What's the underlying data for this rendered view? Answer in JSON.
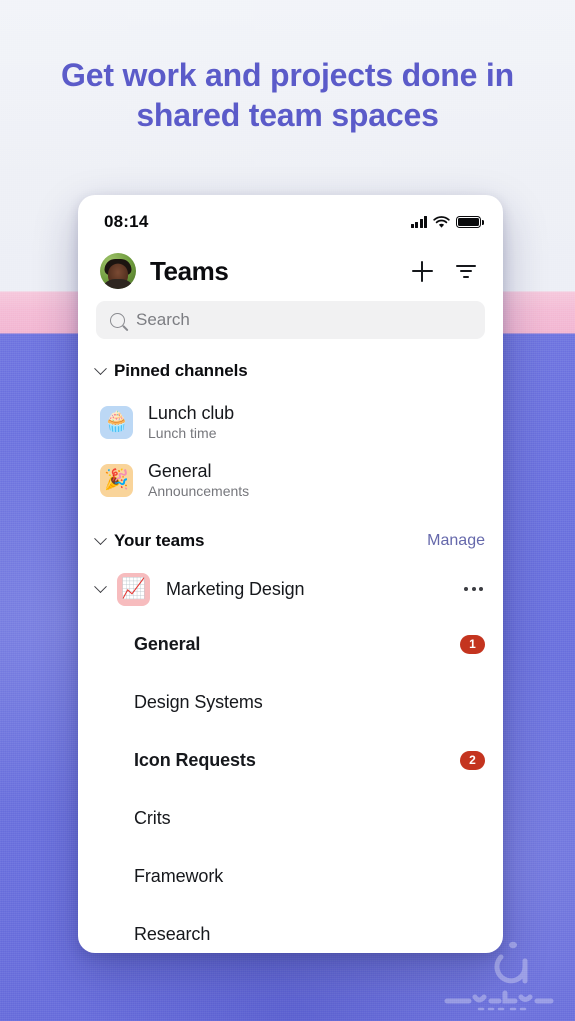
{
  "promo": {
    "headline": "Get work and projects done in shared team spaces",
    "background_top_color": "#eef0f6",
    "background_band_color": "#f2b6d2",
    "background_bottom_color": "#6b72de",
    "headline_color": "#5b5bc9"
  },
  "status_bar": {
    "time": "08:14",
    "signal_icon": "cellular-signal-icon",
    "wifi_icon": "wifi-icon",
    "battery_icon": "battery-full-icon"
  },
  "app_header": {
    "avatar": "user-avatar",
    "title": "Teams",
    "add_icon": "plus-icon",
    "filter_icon": "filter-icon"
  },
  "search": {
    "icon": "search-icon",
    "placeholder": "Search",
    "value": ""
  },
  "pinned_section": {
    "title": "Pinned channels",
    "chevron_icon": "chevron-down-icon",
    "items": [
      {
        "emoji": "🧁",
        "tile_color": "#bcd8f5",
        "title": "Lunch club",
        "subtitle": "Lunch time"
      },
      {
        "emoji": "🎉",
        "tile_color": "#f9d49a",
        "title": "General",
        "subtitle": "Announcements"
      }
    ]
  },
  "teams_section": {
    "title": "Your teams",
    "chevron_icon": "chevron-down-icon",
    "manage_label": "Manage",
    "manage_color": "#6568ab",
    "team": {
      "emoji": "📈",
      "tile_color": "#f7bcbe",
      "name": "Marketing Design",
      "chevron_icon": "chevron-down-icon",
      "more_icon": "more-options-icon"
    },
    "channels": [
      {
        "name": "General",
        "unread": true,
        "badge": "1"
      },
      {
        "name": "Design Systems",
        "unread": false,
        "badge": ""
      },
      {
        "name": "Icon Requests",
        "unread": true,
        "badge": "2"
      },
      {
        "name": "Crits",
        "unread": false,
        "badge": ""
      },
      {
        "name": "Framework",
        "unread": false,
        "badge": ""
      },
      {
        "name": "Research",
        "unread": false,
        "badge": ""
      }
    ],
    "badge_color": "#c4341f"
  },
  "watermark": {
    "name": "sibche-store-watermark"
  }
}
